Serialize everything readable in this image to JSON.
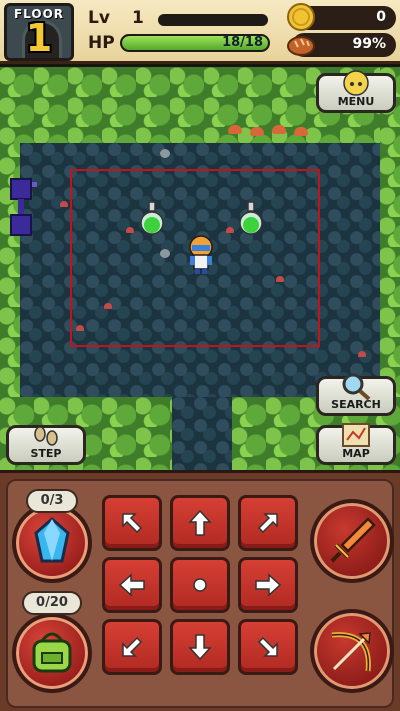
{
  "hud": {
    "floor_label": "FLOOR",
    "floor_number": "1",
    "level_label": "Lv",
    "level_value": "1",
    "exp_progress": 0,
    "hp_label": "HP",
    "hp_text": "18/18",
    "hp_progress": 1.0,
    "gold_value": "0",
    "food_value": "99%"
  },
  "side_buttons": {
    "menu_label": "MENU",
    "search_label": "SEARCH",
    "step_label": "STEP",
    "map_label": "MAP"
  },
  "panel": {
    "gem_count": "0/3",
    "bag_count": "0/20"
  },
  "icons": {
    "gold": "coin-icon",
    "food": "bread-icon",
    "hero": "hero-character",
    "potion": "green-potion-icon"
  },
  "colors": {
    "room_outline": "#c0141c",
    "hp_fill": "#56a82a",
    "dpad": "#d63f34"
  }
}
